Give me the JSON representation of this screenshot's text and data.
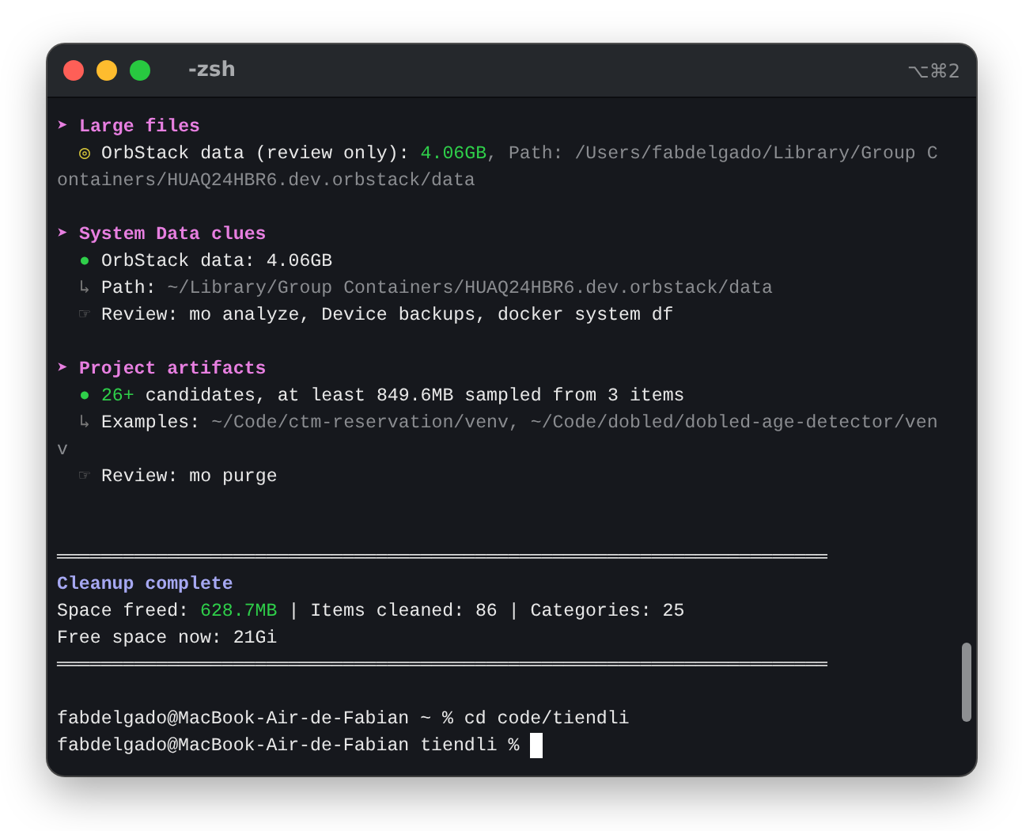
{
  "window": {
    "title": "-zsh",
    "shortcut": "⌥⌘2"
  },
  "lines": [
    {
      "indent": false,
      "segments": [
        {
          "kind": "marker",
          "text": "➤"
        },
        {
          "kind": "heading",
          "text": "Large files"
        }
      ]
    },
    {
      "indent": true,
      "segments": [
        {
          "kind": "warn",
          "text": "◎"
        },
        {
          "kind": "strong",
          "text": "OrbStack data (review only):"
        },
        {
          "kind": "value",
          "text": "4.06GB"
        },
        {
          "kind": "muted",
          "text": ", Path: /Users/fabdelgado/Library/Group C"
        }
      ]
    },
    {
      "indent": false,
      "segments": [
        {
          "kind": "muted",
          "text": "ontainers/HUAQ24HBR6.dev.orbstack/data"
        }
      ]
    },
    {
      "indent": false,
      "gap_before": true,
      "segments": [
        {
          "kind": "marker",
          "text": "➤"
        },
        {
          "kind": "heading",
          "text": "System Data clues"
        }
      ]
    },
    {
      "indent": true,
      "segments": [
        {
          "kind": "ok",
          "text": "●"
        },
        {
          "kind": "strong",
          "text": "OrbStack data: 4.06GB"
        }
      ]
    },
    {
      "indent": true,
      "segments": [
        {
          "kind": "dim",
          "text": "↳"
        },
        {
          "kind": "strong",
          "text": "Path:"
        },
        {
          "kind": "muted",
          "text": "~/Library/Group Containers/HUAQ24HBR6.dev.orbstack/data"
        }
      ]
    },
    {
      "indent": true,
      "segments": [
        {
          "kind": "dim",
          "text": "☞"
        },
        {
          "kind": "strong",
          "text": "Review: mo analyze, Device backups, docker system df"
        }
      ]
    },
    {
      "indent": false,
      "gap_before": true,
      "segments": [
        {
          "kind": "marker",
          "text": "➤"
        },
        {
          "kind": "heading",
          "text": "Project artifacts"
        }
      ]
    },
    {
      "indent": true,
      "segments": [
        {
          "kind": "ok",
          "text": "●"
        },
        {
          "kind": "value",
          "text": "26+"
        },
        {
          "kind": "strong",
          "text": "candidates, at least 849.6MB sampled from 3 items"
        }
      ]
    },
    {
      "indent": true,
      "segments": [
        {
          "kind": "dim",
          "text": "↳"
        },
        {
          "kind": "strong",
          "text": "Examples:"
        },
        {
          "kind": "muted",
          "text": "~/Code/ctm-reservation/venv, ~/Code/dobled/dobled-age-detector/ven"
        }
      ]
    },
    {
      "indent": false,
      "segments": [
        {
          "kind": "muted",
          "text": "v"
        }
      ]
    },
    {
      "indent": true,
      "segments": [
        {
          "kind": "dim",
          "text": "☞"
        },
        {
          "kind": "strong",
          "text": "Review: mo purge"
        }
      ]
    },
    {
      "indent": false,
      "gap_before": true,
      "wide_gap": true,
      "segments": [
        {
          "kind": "rule",
          "text": "══════════════════════════════════════════════════════════════════════"
        }
      ]
    },
    {
      "indent": false,
      "segments": [
        {
          "kind": "title",
          "text": "Cleanup complete"
        }
      ]
    },
    {
      "indent": false,
      "segments": [
        {
          "kind": "text",
          "text": "Space freed:"
        },
        {
          "kind": "value",
          "text": "628.7MB"
        },
        {
          "kind": "text",
          "text": "| Items cleaned: 86 | Categories: 25"
        }
      ]
    },
    {
      "indent": false,
      "segments": [
        {
          "kind": "text",
          "text": "Free space now: 21Gi"
        }
      ]
    },
    {
      "indent": false,
      "segments": [
        {
          "kind": "rule",
          "text": "══════════════════════════════════════════════════════════════════════"
        }
      ]
    },
    {
      "indent": false,
      "gap_before": true,
      "segments": [
        {
          "kind": "text",
          "text": "fabdelgado@MacBook-Air-de-Fabian ~ % cd code/tiendli"
        }
      ]
    },
    {
      "indent": false,
      "segments": [
        {
          "kind": "text",
          "text": "fabdelgado@MacBook-Air-de-Fabian tiendli %"
        },
        {
          "kind": "cursor"
        }
      ]
    }
  ]
}
